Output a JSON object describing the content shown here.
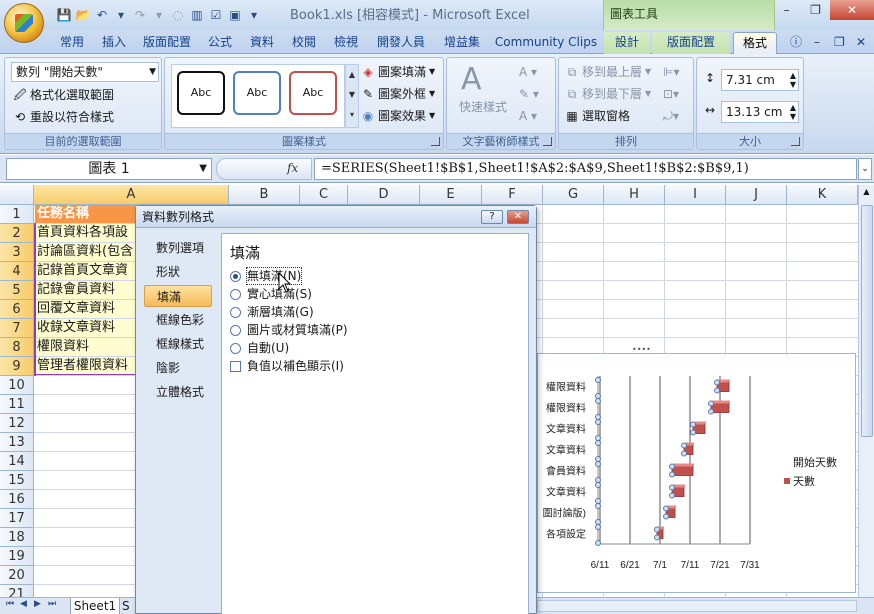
{
  "window": {
    "title": "Book1.xls  [相容模式] - Microsoft Excel",
    "context_tools": "圖表工具",
    "minimize": "–",
    "restore": "❐",
    "close": "✕"
  },
  "ribbon_tabs": [
    "常用",
    "插入",
    "版面配置",
    "公式",
    "資料",
    "校閱",
    "檢視",
    "開發人員",
    "增益集",
    "Community Clips",
    "設計",
    "版面配置",
    "格式"
  ],
  "ribbon": {
    "selection": {
      "combo_value": "數列 \"開始天數\"",
      "format_selection": "格式化選取範圍",
      "reset_style": "重設以符合樣式",
      "group_label": "目前的選取範圍"
    },
    "shape_styles": {
      "abc1": "Abc",
      "abc2": "Abc",
      "abc3": "Abc",
      "shape_fill": "圖案填滿",
      "shape_outline": "圖案外框",
      "shape_effects": "圖案效果",
      "group_label": "圖案樣式"
    },
    "wordart": {
      "quick_styles": "快速樣式",
      "group_label": "文字藝術師樣式"
    },
    "arrange": {
      "bring_front": "移到最上層",
      "send_back": "移到最下層",
      "selection_pane": "選取窗格",
      "group_label": "排列"
    },
    "size": {
      "height": "7.31 cm",
      "width": "13.13 cm",
      "group_label": "大小"
    }
  },
  "formula_bar": {
    "name_box": "圖表 1",
    "fx": "fx",
    "formula": "=SERIES(Sheet1!$B$1,Sheet1!$A$2:$A$9,Sheet1!$B$2:$B$9,1)"
  },
  "grid": {
    "columns": [
      "A",
      "B",
      "C",
      "D",
      "E",
      "F",
      "G",
      "H",
      "I",
      "J",
      "K"
    ],
    "rows": [
      "1",
      "2",
      "3",
      "4",
      "5",
      "6",
      "7",
      "8",
      "9",
      "10",
      "11",
      "12",
      "13",
      "14",
      "15",
      "16",
      "17",
      "18",
      "19",
      "20",
      "21"
    ],
    "cells_a": [
      "任務名稱",
      "首頁資料各項設",
      "討論區資料(包含",
      "記錄首頁文章資",
      "記錄會員資料",
      "回覆文章資料",
      "收錄文章資料",
      "權限資料",
      "管理者權限資料"
    ],
    "sheet_tab": "Sheet1",
    "sheet_tab_more": "S"
  },
  "dialog": {
    "title": "資料數列格式",
    "help": "?",
    "close": "✕",
    "nav": [
      "數列選項",
      "形狀",
      "填滿",
      "框線色彩",
      "框線樣式",
      "陰影",
      "立體格式"
    ],
    "panel_title": "填滿",
    "options": [
      "無填滿(N)",
      "實心填滿(S)",
      "漸層填滿(G)",
      "圖片或材質填滿(P)",
      "自動(U)"
    ],
    "checkbox": "負值以補色顯示(I)"
  },
  "chart_data": {
    "type": "bar",
    "orientation": "horizontal",
    "stacked": true,
    "categories": [
      "各項設定",
      "圍討論版)",
      "文章資料",
      "會員資料",
      "文章資料",
      "文章資料",
      "權限資料",
      "權限資料"
    ],
    "x_tick_labels": [
      "6/11",
      "6/21",
      "7/1",
      "7/11",
      "7/21",
      "7/31"
    ],
    "series": [
      {
        "name": "開始天數",
        "values": [
          "6/30",
          "7/3",
          "7/5",
          "7/5",
          "7/9",
          "7/12",
          "7/18",
          "7/20"
        ],
        "fill": "none"
      },
      {
        "name": "天數",
        "values": [
          2,
          3,
          4,
          7,
          3,
          4,
          6,
          4
        ],
        "color": "#c0504d"
      }
    ],
    "legend": "right",
    "legend_entries": [
      "開始天數",
      "天數"
    ]
  }
}
